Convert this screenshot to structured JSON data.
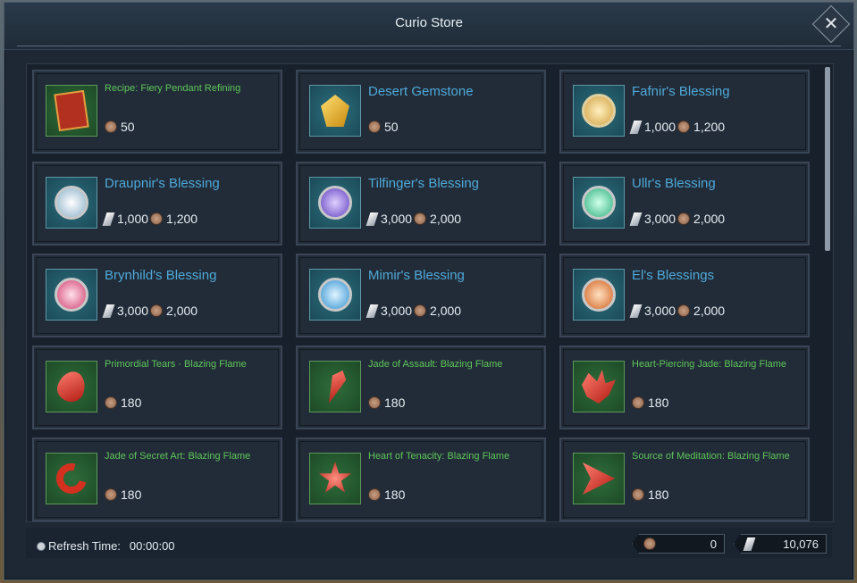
{
  "window": {
    "title": "Curio Store"
  },
  "items": [
    {
      "name": "Recipe: Fiery Pendant Refining",
      "icon": "recipe-book-icon",
      "prices": [
        {
          "currency": "coin",
          "amount": "50"
        }
      ]
    },
    {
      "name": "Desert Gemstone",
      "icon": "gold-gemstone-icon",
      "prices": [
        {
          "currency": "coin",
          "amount": "50"
        }
      ]
    },
    {
      "name": "Fafnir's Blessing",
      "icon": "gold-orb-icon",
      "prices": [
        {
          "currency": "shard",
          "amount": "1,000"
        },
        {
          "currency": "coin",
          "amount": "1,200"
        }
      ]
    },
    {
      "name": "Draupnir's Blessing",
      "icon": "white-orb-icon",
      "prices": [
        {
          "currency": "shard",
          "amount": "1,000"
        },
        {
          "currency": "coin",
          "amount": "1,200"
        }
      ]
    },
    {
      "name": "Tilfinger's Blessing",
      "icon": "purple-orb-icon",
      "prices": [
        {
          "currency": "shard",
          "amount": "3,000"
        },
        {
          "currency": "coin",
          "amount": "2,000"
        }
      ]
    },
    {
      "name": "Ullr's Blessing",
      "icon": "green-orb-icon",
      "prices": [
        {
          "currency": "shard",
          "amount": "3,000"
        },
        {
          "currency": "coin",
          "amount": "2,000"
        }
      ]
    },
    {
      "name": "Brynhild's Blessing",
      "icon": "pink-orb-icon",
      "prices": [
        {
          "currency": "shard",
          "amount": "3,000"
        },
        {
          "currency": "coin",
          "amount": "2,000"
        }
      ]
    },
    {
      "name": "Mimir's Blessing",
      "icon": "blue-orb-icon",
      "prices": [
        {
          "currency": "shard",
          "amount": "3,000"
        },
        {
          "currency": "coin",
          "amount": "2,000"
        }
      ]
    },
    {
      "name": "El's Blessings",
      "icon": "orange-orb-icon",
      "prices": [
        {
          "currency": "shard",
          "amount": "3,000"
        },
        {
          "currency": "coin",
          "amount": "2,000"
        }
      ]
    },
    {
      "name": "Primordial Tears · Blazing Flame",
      "icon": "red-teardrop-gem-icon",
      "prices": [
        {
          "currency": "coin",
          "amount": "180"
        }
      ]
    },
    {
      "name": "Jade of Assault: Blazing Flame",
      "icon": "red-shard-gem-icon",
      "prices": [
        {
          "currency": "coin",
          "amount": "180"
        }
      ]
    },
    {
      "name": "Heart-Piercing Jade: Blazing Flame",
      "icon": "red-crystal-cluster-icon",
      "prices": [
        {
          "currency": "coin",
          "amount": "180"
        }
      ]
    },
    {
      "name": "Jade of Secret Art: Blazing Flame",
      "icon": "red-crescent-gem-icon",
      "prices": [
        {
          "currency": "coin",
          "amount": "180"
        }
      ]
    },
    {
      "name": "Heart of Tenacity: Blazing Flame",
      "icon": "red-star-gem-icon",
      "prices": [
        {
          "currency": "coin",
          "amount": "180"
        }
      ]
    },
    {
      "name": "Source of Meditation: Blazing Flame",
      "icon": "red-triangle-gem-icon",
      "prices": [
        {
          "currency": "coin",
          "amount": "180"
        }
      ]
    }
  ],
  "footer": {
    "refresh_label": "Refresh Time:",
    "refresh_time": "00:00:00",
    "coin_balance": "0",
    "shard_balance": "10,076"
  },
  "colors": {
    "name_large": "#4ea9d9",
    "name_small": "#5ec65a"
  }
}
